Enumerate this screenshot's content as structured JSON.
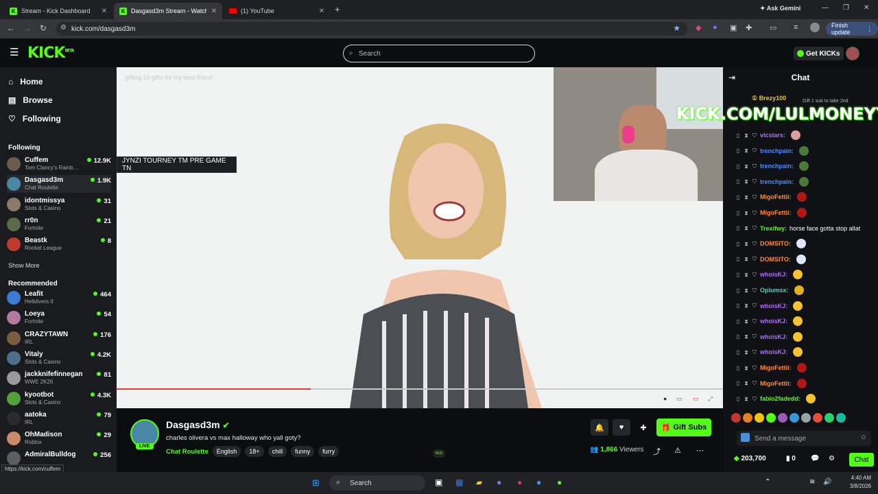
{
  "browser": {
    "tabs": [
      {
        "title": "Stream - Kick Dashboard",
        "favicon": "kick-icon"
      },
      {
        "title": "Dasgasd3m Stream - Watch Live",
        "favicon": "kick-icon"
      },
      {
        "title": "(1) YouTube",
        "favicon": "youtube-icon"
      }
    ],
    "url": "kick.com/dasgasd3m",
    "ask_gemini": "Ask Gemini",
    "finish_update": "Finish update",
    "status_url": "https://kick.com/cuffem"
  },
  "header": {
    "logo": "KICK",
    "logo_badge": "BETA",
    "search_placeholder": "Search",
    "get_kicks": "Get KICKs"
  },
  "sidebar": {
    "nav": [
      "Home",
      "Browse",
      "Following"
    ],
    "following_title": "Following",
    "following": [
      {
        "name": "Cuffem",
        "category": "Tom Clancy's Rainb…",
        "viewers": "12.9K",
        "color": "#6b5a4e"
      },
      {
        "name": "Dasgasd3m",
        "category": "Chat Roulette",
        "viewers": "1.9K",
        "color": "#4a86a6"
      },
      {
        "name": "idontmissya",
        "category": "Slots & Casino",
        "viewers": "31",
        "color": "#8a7a6a"
      },
      {
        "name": "rr0n",
        "category": "Fortnite",
        "viewers": "21",
        "color": "#5a6a4a"
      },
      {
        "name": "Beastk",
        "category": "Rocket League",
        "viewers": "8",
        "color": "#c0392b"
      }
    ],
    "show_more": "Show More",
    "recommended_title": "Recommended",
    "recommended": [
      {
        "name": "Leafit",
        "category": "Helldivers II",
        "viewers": "464",
        "color": "#3a7bd5"
      },
      {
        "name": "Loeya",
        "category": "Fortnite",
        "viewers": "54",
        "color": "#b07aa1"
      },
      {
        "name": "CRAZYTAWN",
        "category": "IRL",
        "viewers": "176",
        "color": "#7a5c3e"
      },
      {
        "name": "Vitaly",
        "category": "Slots & Casino",
        "viewers": "4.2K",
        "color": "#4e6e8e"
      },
      {
        "name": "jackknifefinnegan",
        "category": "WWE 2K26",
        "viewers": "81",
        "color": "#9a9a9a"
      },
      {
        "name": "kyootbot",
        "category": "Slots & Casino",
        "viewers": "4.3K",
        "color": "#53a13a"
      },
      {
        "name": "aatoka",
        "category": "IRL",
        "viewers": "79",
        "color": "#2b2b2b"
      },
      {
        "name": "OhMadison",
        "category": "Roblox",
        "viewers": "29",
        "color": "#c98a6a"
      },
      {
        "name": "AdmiralBulldog",
        "category": "",
        "viewers": "256",
        "color": "#5e5e5e"
      }
    ]
  },
  "video": {
    "caption": "gifting 10 gifts for my best friend",
    "overlay_tag": "JYNZI TOURNEY TM PRE GAME TN",
    "progress": 0.32
  },
  "stream": {
    "name": "Dasgasd3m",
    "live": "LIVE",
    "title": "charles olivera vs max halloway who yall goty?",
    "category": "Chat Roulette",
    "tags": [
      "English",
      "18+",
      "chill",
      "funny",
      "furry"
    ],
    "gift_subs": "Gift Subs",
    "viewer_count": "1,866",
    "viewers_label": "Viewers"
  },
  "chat": {
    "title": "Chat",
    "pinned_user": "Brezy100",
    "pinned_note": "Gift 1 sub to take 2nd",
    "banner": "KICK.COM/LULMONEYY",
    "messages": [
      {
        "user": "vicstars",
        "text": "",
        "color": "#b36bff",
        "emote": "#d9a0a0"
      },
      {
        "user": "trenchpain",
        "text": "",
        "color": "#4f8cff",
        "emote": "#4a7a3a"
      },
      {
        "user": "trenchpain",
        "text": "",
        "color": "#4f8cff",
        "emote": "#4a7a3a"
      },
      {
        "user": "trenchpain",
        "text": "",
        "color": "#4f8cff",
        "emote": "#4a7a3a"
      },
      {
        "user": "MigoFettii",
        "text": "",
        "color": "#ff8a3d",
        "emote": "#b01818"
      },
      {
        "user": "MigoFettii",
        "text": "",
        "color": "#ff8a3d",
        "emote": "#b01818"
      },
      {
        "user": "Trexifwy",
        "text": "horse face gotta stop allat",
        "color": "#53fc18",
        "emote": ""
      },
      {
        "user": "DOMSITO",
        "text": "",
        "color": "#ff8a3d",
        "emote": "#dfe6ff"
      },
      {
        "user": "DOMSITO",
        "text": "",
        "color": "#ff8a3d",
        "emote": "#dfe6ff"
      },
      {
        "user": "whoisKJ",
        "text": "",
        "color": "#b36bff",
        "emote": "#f2c230"
      },
      {
        "user": "Oplumsx",
        "text": "",
        "color": "#4fd1c5",
        "emote": "#e0b020"
      },
      {
        "user": "whoisKJ",
        "text": "",
        "color": "#b36bff",
        "emote": "#f2c230"
      },
      {
        "user": "whoisKJ",
        "text": "",
        "color": "#b36bff",
        "emote": "#f2c230"
      },
      {
        "user": "whoisKJ",
        "text": "",
        "color": "#b36bff",
        "emote": "#f2c230"
      },
      {
        "user": "whoisKJ",
        "text": "",
        "color": "#b36bff",
        "emote": "#f2c230"
      },
      {
        "user": "MigoFettii",
        "text": "",
        "color": "#ff8a3d",
        "emote": "#b01818"
      },
      {
        "user": "MigoFettii",
        "text": "",
        "color": "#ff8a3d",
        "emote": "#b01818"
      },
      {
        "user": "fabio2fadedd",
        "text": "",
        "color": "#53fc18",
        "emote": "#f2c230"
      }
    ],
    "send_placeholder": "Send a message",
    "points": "203,700",
    "zero": "0",
    "chat_button": "Chat"
  },
  "taskbar": {
    "search": "Search",
    "time": "4:40 AM",
    "date": "3/8/2026"
  }
}
